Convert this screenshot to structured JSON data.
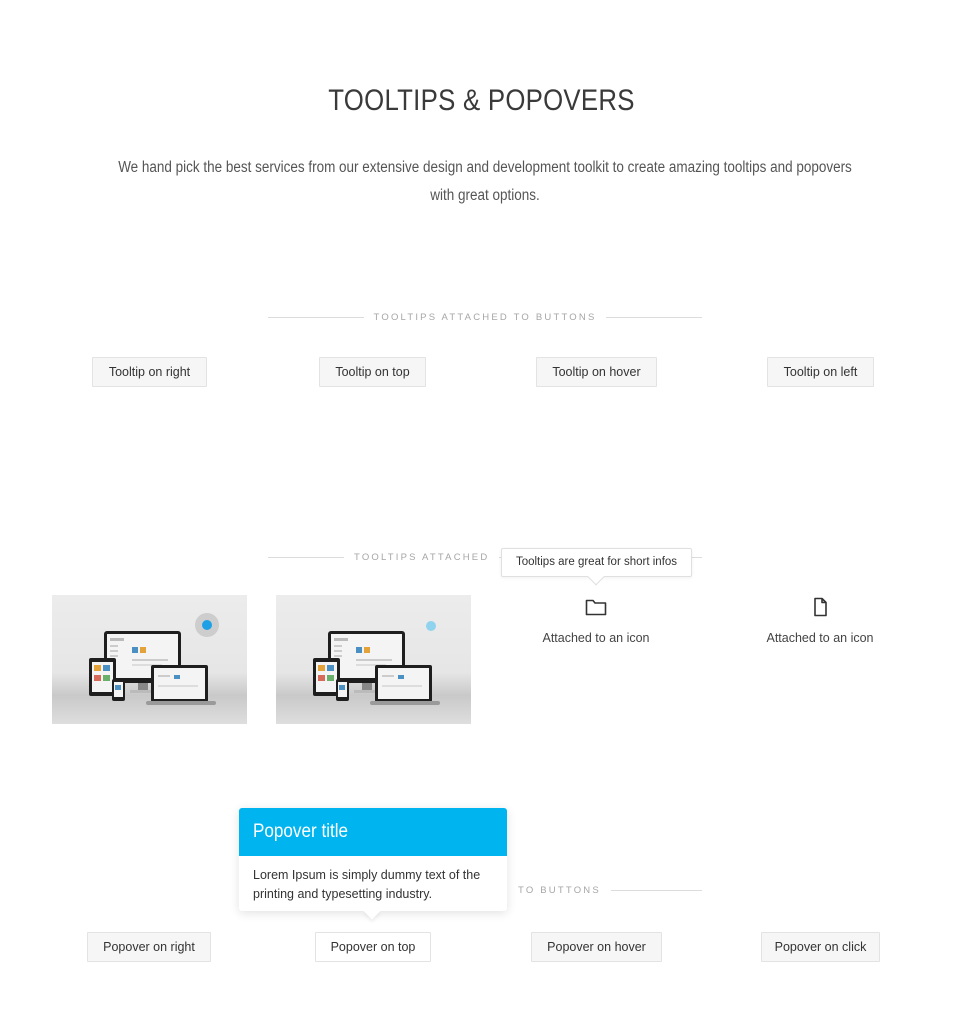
{
  "header": {
    "title": "TOOLTIPS & POPOVERS",
    "subtitle": "We hand pick the best services from our extensive design and development toolkit to create amazing tooltips and popovers with great options."
  },
  "sections": {
    "buttons_tooltips": {
      "label": "TOOLTIPS ATTACHED TO BUTTONS",
      "buttons": [
        "Tooltip on right",
        "Tooltip on top",
        "Tooltip on hover",
        "Tooltip on left"
      ]
    },
    "icons_tooltips": {
      "label_visible": "TOOLTIPS ATTACHED",
      "icon_labels": [
        "Attached to an icon",
        "Attached to an icon"
      ],
      "icons": [
        "folder-icon",
        "file-icon"
      ],
      "tooltip_text": "Tooltips are great for short infos",
      "dot_colors": [
        "#1ea0e6",
        "#8fd3ee"
      ]
    },
    "popovers": {
      "label_visible": "TO BUTTONS",
      "buttons": [
        "Popover on right",
        "Popover on top",
        "Popover on hover",
        "Popover on click"
      ],
      "popover": {
        "title": "Popover title",
        "body": "Lorem Ipsum is simply dummy text of the printing and typesetting industry."
      }
    }
  },
  "colors": {
    "accent": "#00b4f0"
  }
}
